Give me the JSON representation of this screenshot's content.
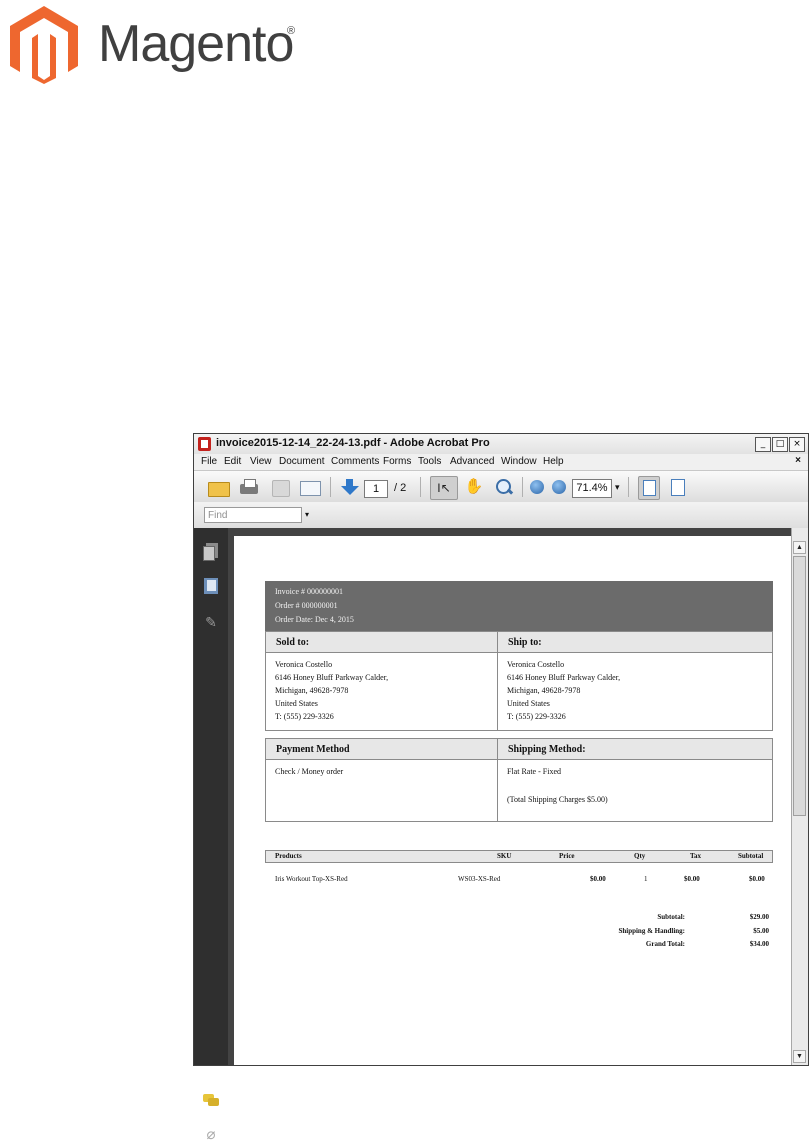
{
  "brand": {
    "name": "Magento",
    "reg_mark": "®",
    "colors": {
      "orange": "#ee672f",
      "text": "#404040"
    }
  },
  "window": {
    "title": "invoice2015-12-14_22-24-13.pdf - Adobe Acrobat Pro",
    "buttons": {
      "minimize": "_",
      "maximize": "□",
      "close": "×"
    },
    "menu": [
      "File",
      "Edit",
      "View",
      "Document",
      "Comments",
      "Forms",
      "Tools",
      "Advanced",
      "Window",
      "Help"
    ],
    "menu_close": "×",
    "toolbar": {
      "page_current": "1",
      "page_total": "/ 2",
      "zoom": "71.4%",
      "zoom_dropdown": "▾"
    },
    "find": {
      "placeholder": "Find",
      "dropdown": "▾"
    },
    "icons": [
      "open-folder-icon",
      "print-icon",
      "save-icon",
      "email-icon",
      "next-page-icon",
      "select-tool-icon",
      "hand-tool-icon",
      "marquee-zoom-icon",
      "zoom-out-icon",
      "zoom-in-icon",
      "fit-page-icon",
      "fit-width-icon",
      "pages-icon",
      "bookmarks-icon",
      "signatures-icon",
      "comments-icon",
      "attachments-icon"
    ]
  },
  "invoice": {
    "header": {
      "invoice_no": "Invoice # 000000001",
      "order_no": "Order # 000000001",
      "order_date": "Order Date: Dec 4, 2015"
    },
    "sold_to": {
      "heading": "Sold to:",
      "lines": [
        "Veronica Costello",
        "6146 Honey Bluff Parkway Calder,",
        "Michigan, 49628-7978",
        "United States",
        "T: (555) 229-3326"
      ]
    },
    "ship_to": {
      "heading": "Ship to:",
      "lines": [
        "Veronica Costello",
        "6146 Honey Bluff Parkway Calder,",
        "Michigan, 49628-7978",
        "United States",
        "T: (555) 229-3326"
      ]
    },
    "payment": {
      "heading": "Payment Method",
      "value": "Check / Money order"
    },
    "shipping": {
      "heading": "Shipping Method:",
      "value": "Flat Rate - Fixed",
      "charges": "(Total Shipping Charges $5.00)"
    },
    "products": {
      "columns": [
        "Products",
        "SKU",
        "Price",
        "Qty",
        "Tax",
        "Subtotal"
      ],
      "rows": [
        {
          "product": "Iris Workout Top-XS-Red",
          "sku": "WS03-XS-Red",
          "price": "$0.00",
          "qty": "1",
          "tax": "$0.00",
          "subtotal": "$0.00"
        }
      ]
    },
    "totals": [
      {
        "label": "Subtotal:",
        "value": "$29.00"
      },
      {
        "label": "Shipping & Handling:",
        "value": "$5.00"
      },
      {
        "label": "Grand Total:",
        "value": "$34.00"
      }
    ]
  }
}
